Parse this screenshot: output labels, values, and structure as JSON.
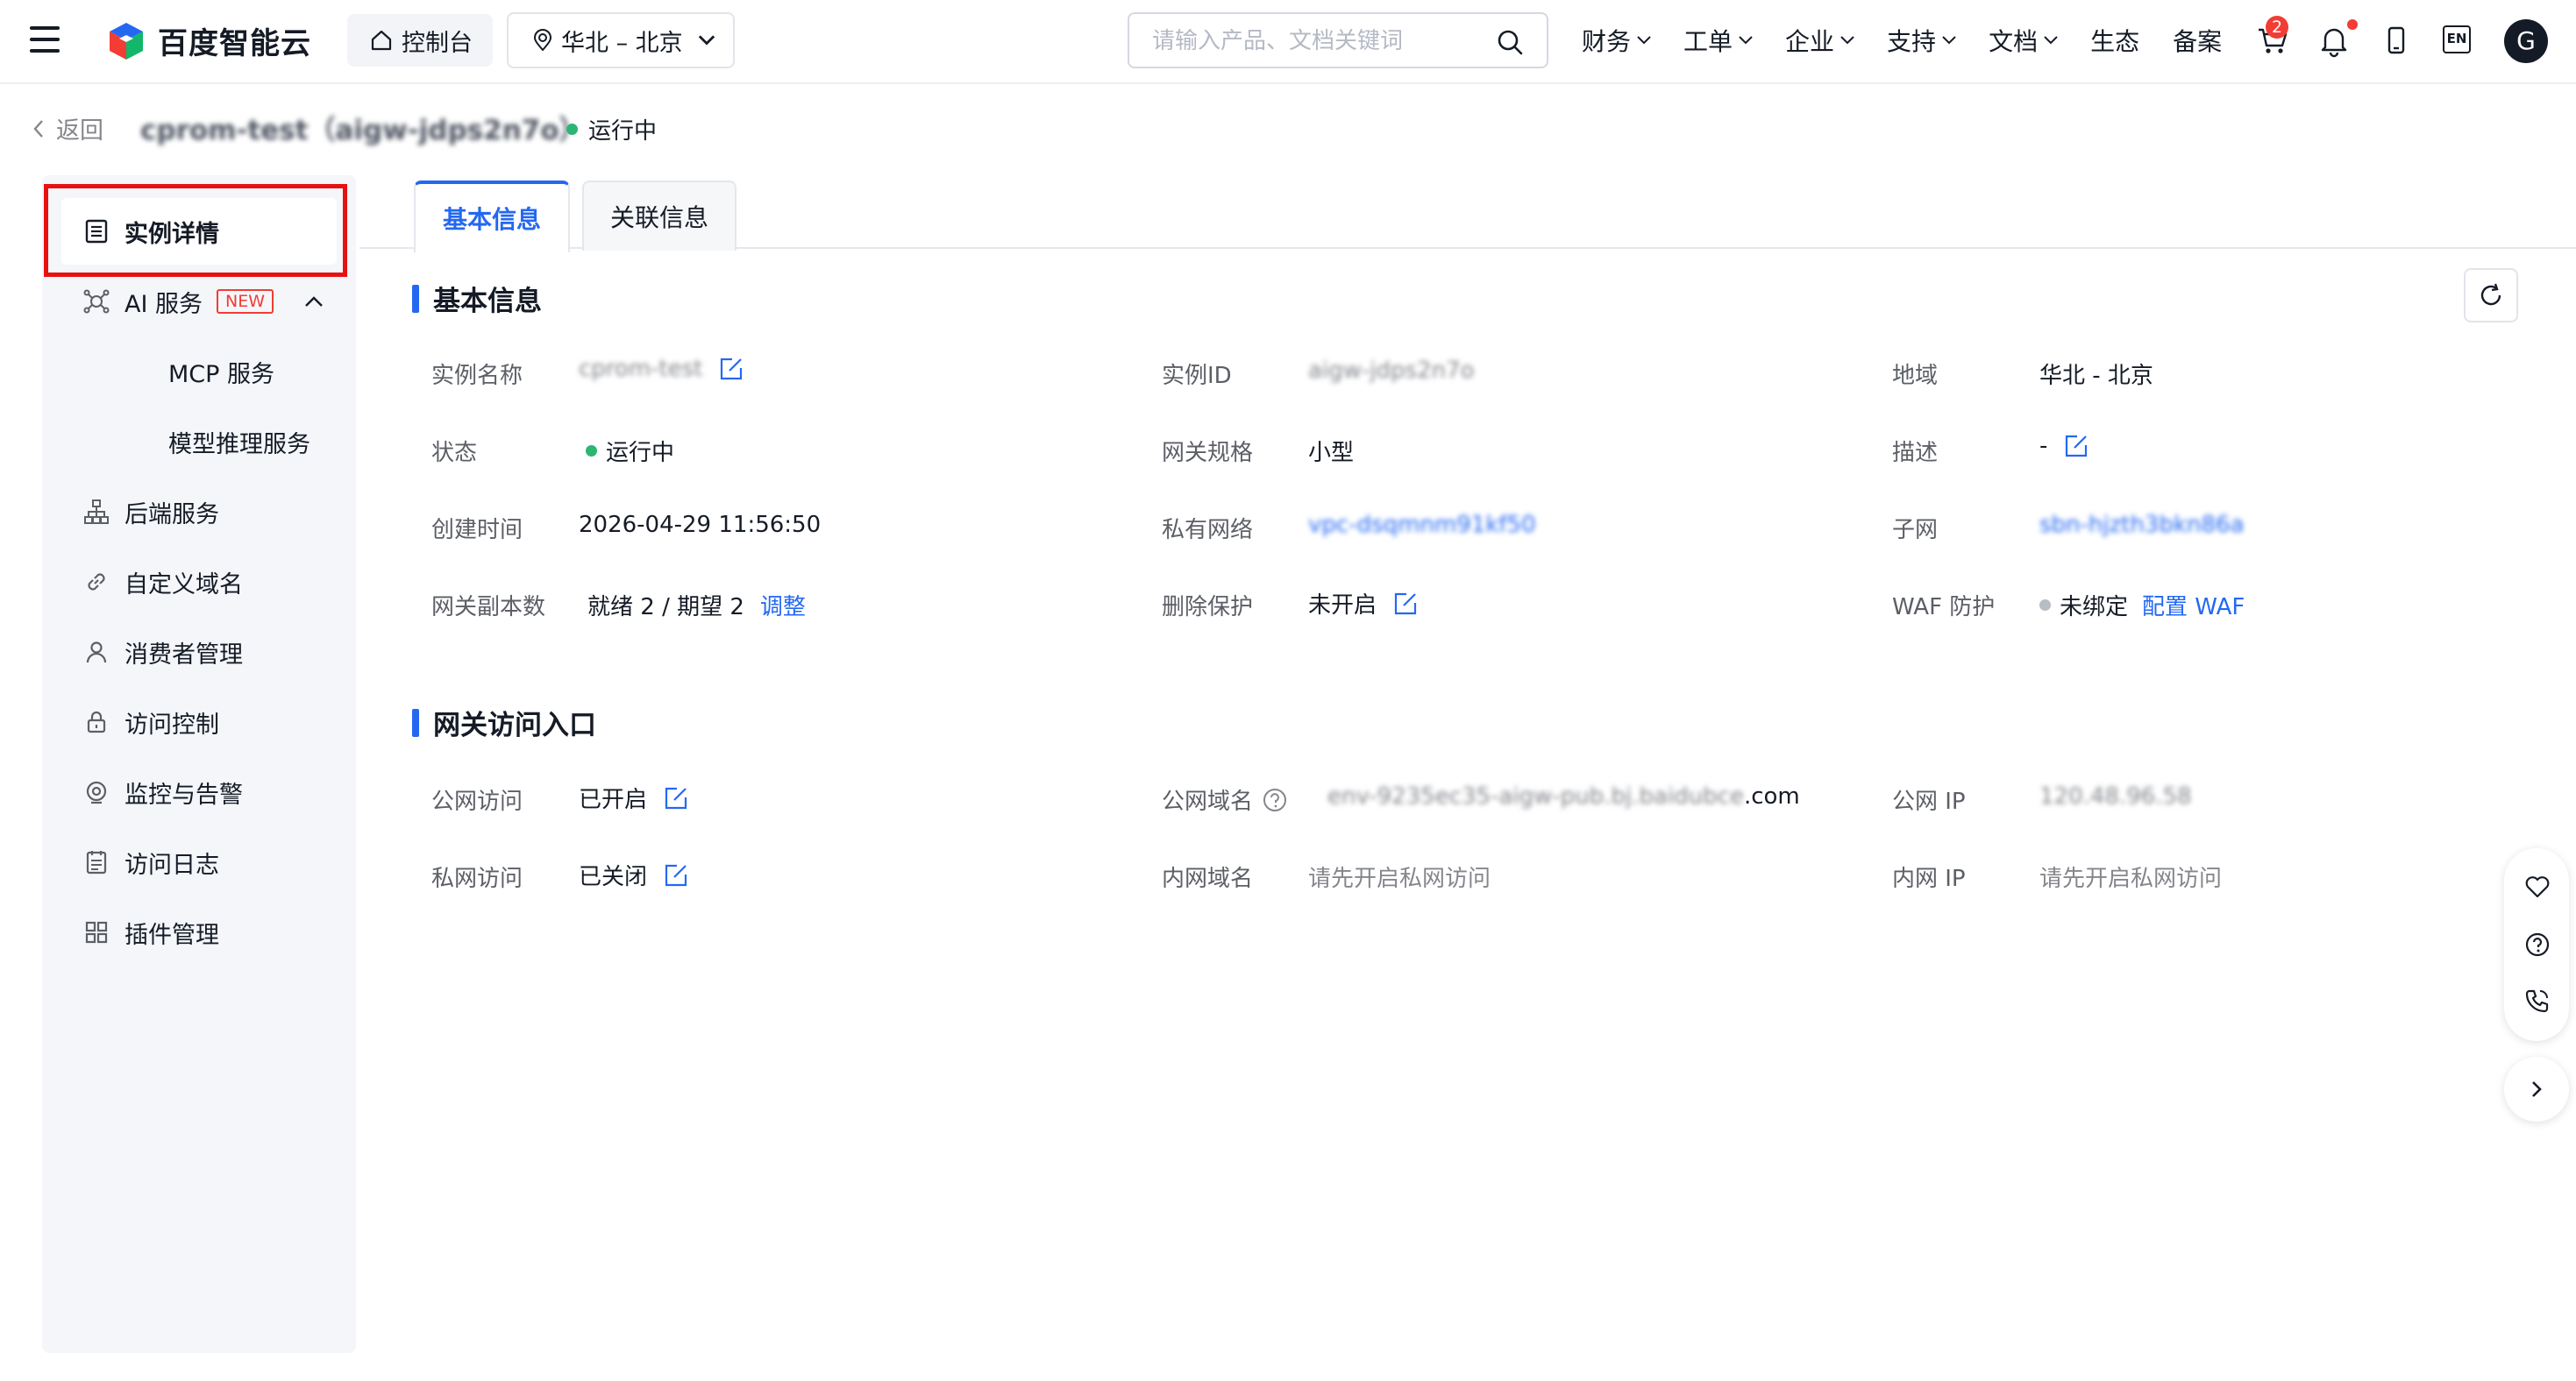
{
  "header": {
    "logo_text": "百度智能云",
    "console_label": "控制台",
    "region_label": "华北 – 北京",
    "search_placeholder": "请输入产品、文档关键词",
    "nav": [
      {
        "label": "财务"
      },
      {
        "label": "工单"
      },
      {
        "label": "企业"
      },
      {
        "label": "支持"
      },
      {
        "label": "文档"
      },
      {
        "label": "生态"
      },
      {
        "label": "备案"
      }
    ],
    "cart_badge": "2",
    "lang_label": "EN",
    "avatar_letter": "G"
  },
  "breadcrumb": {
    "back_label": "返回",
    "instance_title": "cprom-test（aigw-jdps2n7o）",
    "status": "运行中"
  },
  "sidebar": {
    "items": [
      {
        "label": "实例详情",
        "icon": "list-icon"
      },
      {
        "label": "AI 服务",
        "icon": "ai-icon",
        "tag": "NEW"
      },
      {
        "label": "MCP 服务"
      },
      {
        "label": "模型推理服务"
      },
      {
        "label": "后端服务",
        "icon": "hierarchy-icon"
      },
      {
        "label": "自定义域名",
        "icon": "link-icon"
      },
      {
        "label": "消费者管理",
        "icon": "user-icon"
      },
      {
        "label": "访问控制",
        "icon": "lock-icon"
      },
      {
        "label": "监控与告警",
        "icon": "monitor-icon"
      },
      {
        "label": "访问日志",
        "icon": "log-icon"
      },
      {
        "label": "插件管理",
        "icon": "grid-icon"
      }
    ]
  },
  "tabs": [
    {
      "label": "基本信息",
      "active": true
    },
    {
      "label": "关联信息",
      "active": false
    }
  ],
  "basic": {
    "title": "基本信息",
    "instance_name_label": "实例名称",
    "instance_name": "cprom-test",
    "instance_id_label": "实例ID",
    "instance_id": "aigw-jdps2n7o",
    "region_label": "地域",
    "region": "华北 - 北京",
    "status_label": "状态",
    "status": "运行中",
    "spec_label": "网关规格",
    "spec": "小型",
    "desc_label": "描述",
    "desc": "-",
    "created_label": "创建时间",
    "created": "2026-04-29 11:56:50",
    "vpc_label": "私有网络",
    "vpc": "vpc-dsqmnm91kf50",
    "subnet_label": "子网",
    "subnet": "sbn-hjzth3bkn86a",
    "replicas_label": "网关副本数",
    "replicas": "就绪 2 / 期望 2",
    "replicas_action": "调整",
    "delete_protect_label": "删除保护",
    "delete_protect": "未开启",
    "waf_label": "WAF 防护",
    "waf_status": "未绑定",
    "waf_action": "配置 WAF"
  },
  "access": {
    "title": "网关访问入口",
    "public_label": "公网访问",
    "public": "已开启",
    "public_domain_label": "公网域名",
    "public_domain": "env-9235ec35-aigw-pub.bj.baidubce",
    "public_domain_suffix": ".com",
    "public_ip_label": "公网 IP",
    "public_ip": "120.48.96.58",
    "private_label": "私网访问",
    "private": "已关闭",
    "private_domain_label": "内网域名",
    "private_domain": "请先开启私网访问",
    "private_ip_label": "内网 IP",
    "private_ip": "请先开启私网访问"
  },
  "colors": {
    "accent": "#2468f2",
    "status_green": "#2bb673",
    "alert_red": "#f23c34"
  }
}
